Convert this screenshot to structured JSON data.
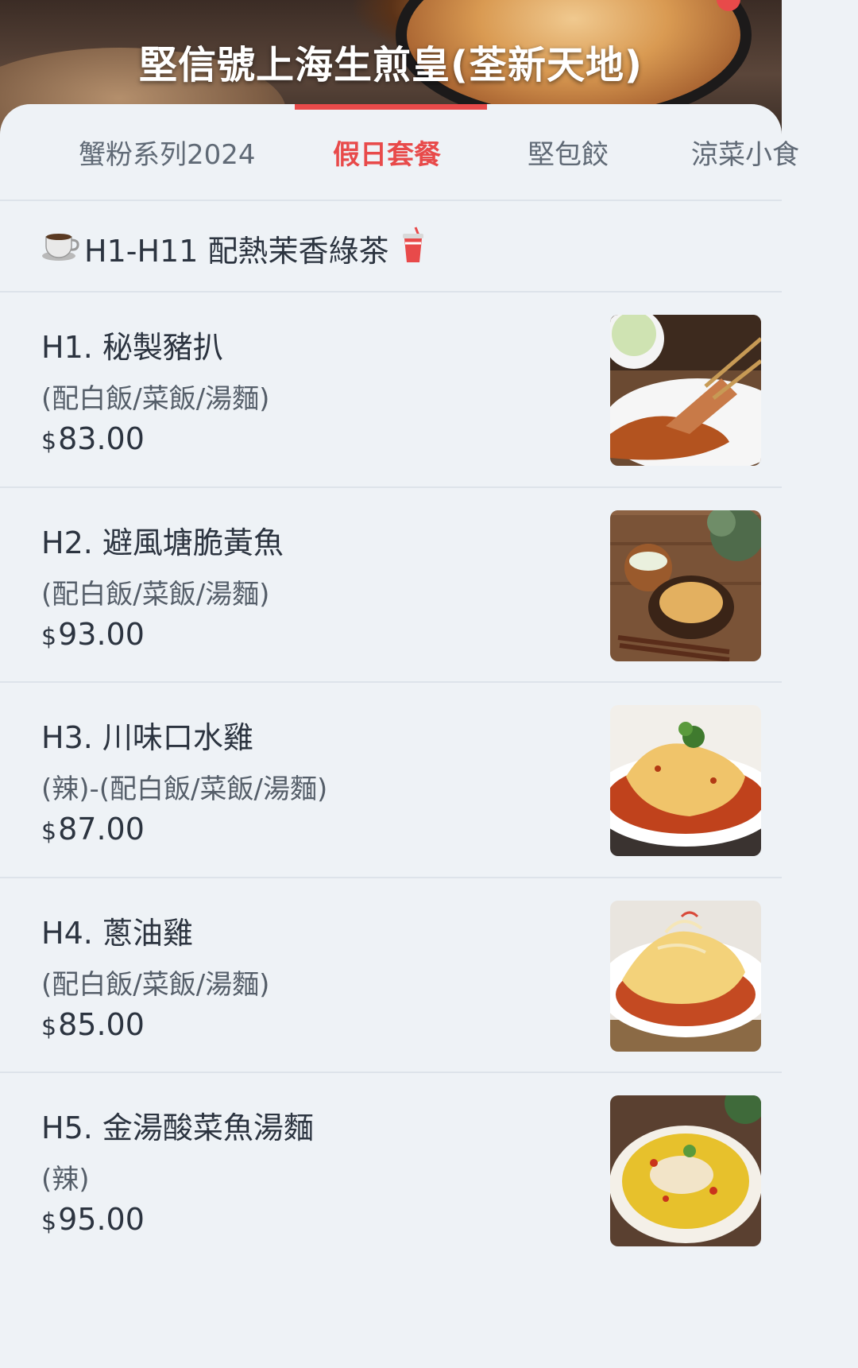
{
  "header": {
    "title": "堅信號上海生煎皇(荃新天地)"
  },
  "tabs": [
    {
      "label": "蟹粉系列2024",
      "active": false
    },
    {
      "label": "假日套餐",
      "active": true
    },
    {
      "label": "堅包餃",
      "active": false
    },
    {
      "label": "涼菜小食",
      "active": false
    }
  ],
  "section": {
    "title": "H1-H11 配熱茉香綠茶",
    "lead_icon": "coffee-cup-icon",
    "trail_icon": "drink-cup-icon"
  },
  "items": [
    {
      "name": "H1. 秘製豬扒",
      "desc": "(配白飯/菜飯/湯麵)",
      "currency": "$",
      "price": "83.00",
      "image": "pork-chop-image"
    },
    {
      "name": "H2. 避風塘脆黃魚",
      "desc": "(配白飯/菜飯/湯麵)",
      "currency": "$",
      "price": "93.00",
      "image": "crispy-fish-image"
    },
    {
      "name": "H3. 川味口水雞",
      "desc": "(辣)-(配白飯/菜飯/湯麵)",
      "currency": "$",
      "price": "87.00",
      "image": "mouthwatering-chicken-image"
    },
    {
      "name": "H4. 蔥油雞",
      "desc": "(配白飯/菜飯/湯麵)",
      "currency": "$",
      "price": "85.00",
      "image": "scallion-chicken-image"
    },
    {
      "name": "H5. 金湯酸菜魚湯麵",
      "desc": "(辣)",
      "currency": "$",
      "price": "95.00",
      "image": "fish-soup-noodle-image"
    }
  ],
  "colors": {
    "accent": "#e84a4a",
    "background": "#eef2f6",
    "text": "#2c3440"
  }
}
